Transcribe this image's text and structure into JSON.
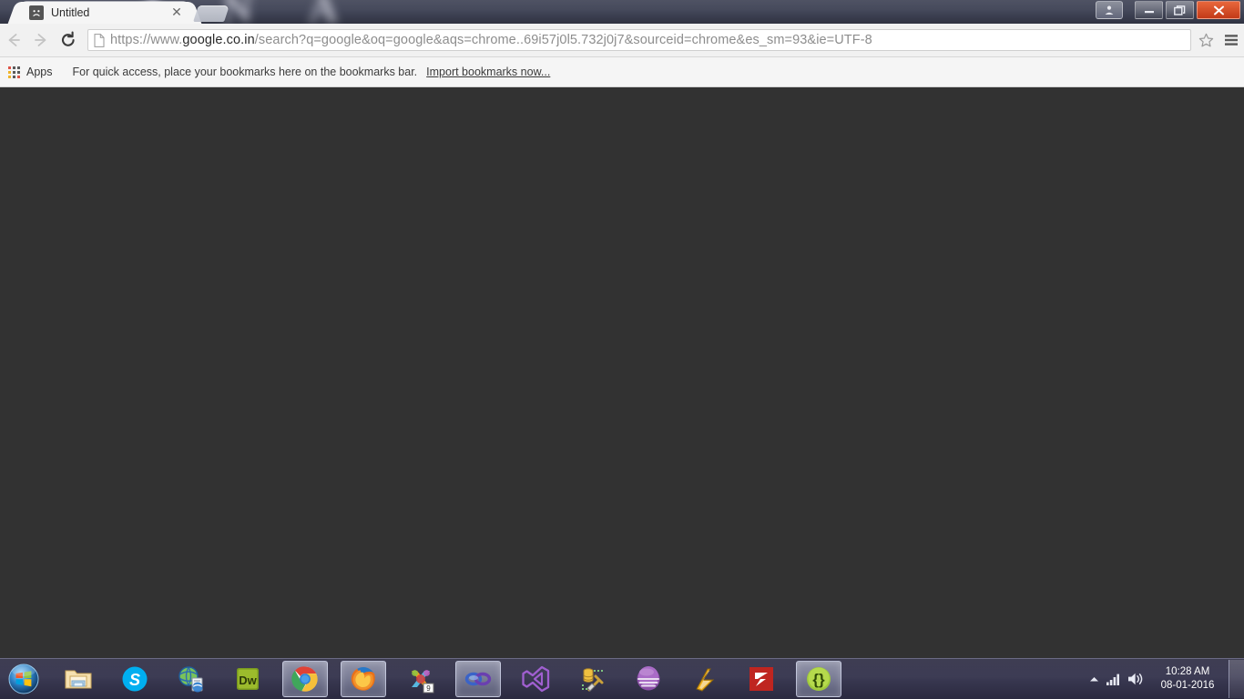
{
  "window": {
    "tab": {
      "title": "Untitled",
      "favicon": "sad-face-icon",
      "close_label": "✕"
    },
    "new_tab_label": "+",
    "controls": {
      "user_label": "user-avatar",
      "minimize_label": "—",
      "restore_label": "❐",
      "close_label": "✕"
    }
  },
  "toolbar": {
    "back_label": "Back",
    "forward_label": "Forward",
    "reload_label": "Reload",
    "page_icon": "document-icon",
    "url_scheme": "https://www.",
    "url_host": "google.co.in",
    "url_path": "/search?q=google&oq=google&aqs=chrome..69i57j0l5.732j0j7&sourceid=chrome&es_sm=93&ie=UTF-8",
    "url_full": "https://www.google.co.in/search?q=google&oq=google&aqs=chrome..69i57j0l5.732j0j7&sourceid=chrome&es_sm=93&ie=UTF-8",
    "star_label": "Bookmark this page",
    "menu_label": "Customize and control Google Chrome"
  },
  "bookmarks_bar": {
    "apps_label": "Apps",
    "hint_text": "For quick access, place your bookmarks here on the bookmarks bar.",
    "import_link": "Import bookmarks now..."
  },
  "content": {
    "background_color": "#323232",
    "text": ""
  },
  "taskbar": {
    "start_label": "Start",
    "items": [
      {
        "name": "file-explorer",
        "label": "Windows Explorer",
        "running": false
      },
      {
        "name": "skype",
        "label": "Skype",
        "running": false
      },
      {
        "name": "network-center",
        "label": "Network and Sharing",
        "running": false
      },
      {
        "name": "dreamweaver",
        "label": "Dw",
        "running": false
      },
      {
        "name": "google-chrome",
        "label": "Google Chrome",
        "running": true
      },
      {
        "name": "mozilla-firefox",
        "label": "Mozilla Firefox",
        "running": true
      },
      {
        "name": "xampp-control",
        "label": "XAMPP",
        "running": false,
        "badge": "9"
      },
      {
        "name": "sql-developer",
        "label": "SQL Developer",
        "running": true
      },
      {
        "name": "visual-studio",
        "label": "Visual Studio",
        "running": false
      },
      {
        "name": "db-tools",
        "label": "Database Tools",
        "running": false
      },
      {
        "name": "eclipse",
        "label": "Eclipse",
        "running": false
      },
      {
        "name": "winamp",
        "label": "Winamp",
        "running": false
      },
      {
        "name": "filezilla",
        "label": "FileZilla",
        "running": false
      },
      {
        "name": "brackets",
        "label": "Brackets",
        "running": true
      }
    ],
    "tray": {
      "arrow_label": "Show hidden icons",
      "network_label": "network-signal-icon",
      "volume_label": "volume-icon",
      "time": "10:28 AM",
      "date": "08-01-2016",
      "show_desktop_label": "Show desktop"
    }
  },
  "wallpaper_text": "A N A"
}
